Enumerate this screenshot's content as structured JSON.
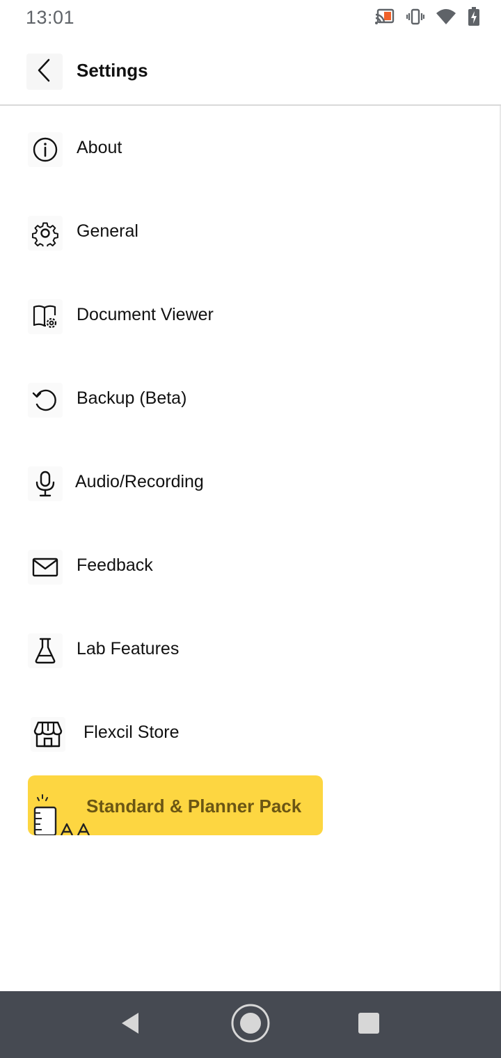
{
  "status": {
    "time": "13:01",
    "icons": [
      "cast-icon",
      "vibrate-icon",
      "wifi-icon",
      "battery-charging-icon"
    ],
    "cast_accent": "#f0612a"
  },
  "header": {
    "back_icon": "chevron-left-icon",
    "title": "Settings"
  },
  "menu": [
    {
      "id": "about",
      "label": "About",
      "icon": "info-icon"
    },
    {
      "id": "general",
      "label": "General",
      "icon": "gear-icon"
    },
    {
      "id": "document-viewer",
      "label": "Document Viewer",
      "icon": "book-gear-icon"
    },
    {
      "id": "backup",
      "label": "Backup (Beta)",
      "icon": "backup-refresh-icon"
    },
    {
      "id": "audio-recording",
      "label": "Audio/Recording",
      "icon": "microphone-icon"
    },
    {
      "id": "feedback",
      "label": "Feedback",
      "icon": "mail-icon"
    },
    {
      "id": "lab-features",
      "label": "Lab Features",
      "icon": "flask-icon"
    },
    {
      "id": "flexcil-store",
      "label": "Flexcil Store",
      "icon": "store-icon"
    }
  ],
  "promo": {
    "label": "Standard & Planner Pack",
    "background": "#fdd641",
    "text_color": "#6b5614"
  },
  "navbar": {
    "icons": [
      "nav-back-icon",
      "nav-home-icon",
      "nav-recents-icon"
    ]
  }
}
